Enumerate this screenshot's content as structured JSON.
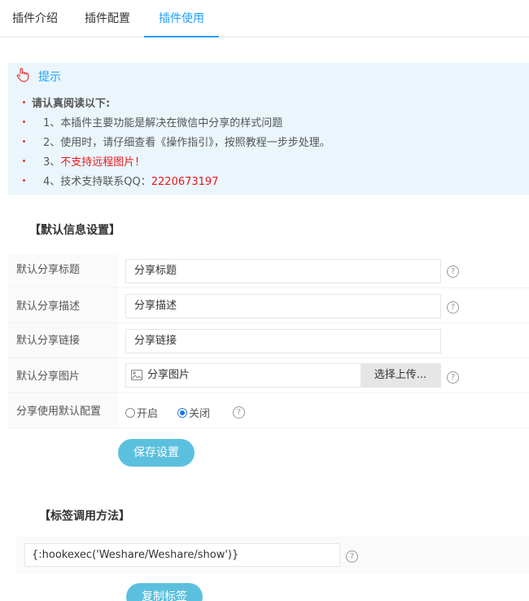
{
  "tabs": [
    {
      "label": "插件介绍"
    },
    {
      "label": "插件配置"
    },
    {
      "label": "插件使用"
    }
  ],
  "tip": {
    "title": "提示",
    "heading": "请认真阅读以下:",
    "items": [
      {
        "text": "1、本插件主要功能是解决在微信中分享的样式问题"
      },
      {
        "text": "2、使用时，请仔细查看《操作指引》，按照教程一步步处理。"
      },
      {
        "prefix": "3、",
        "highlight": "不支持远程图片！"
      },
      {
        "prefix": "4、技术支持联系QQ：",
        "highlight": "2220673197"
      }
    ]
  },
  "settings": {
    "section_title": "【默认信息设置】",
    "title_label": "默认分享标题",
    "title_value": "分享标题",
    "desc_label": "默认分享描述",
    "desc_value": "分享描述",
    "link_label": "默认分享链接",
    "link_value": "分享链接",
    "image_label": "默认分享图片",
    "image_value": "分享图片",
    "upload_label": "选择上传...",
    "use_default_label": "分享使用默认配置",
    "option_on": "开启",
    "option_off": "关闭",
    "selected": "关闭",
    "save_label": "保存设置"
  },
  "tag": {
    "section_title": "【标签调用方法】",
    "code": "{:hookexec('Weshare/Weshare/show')}",
    "copy_label": "复制标签"
  },
  "colors": {
    "accent": "#1e9fff",
    "button": "#5bc0de",
    "tip_bg": "#eaf6fc",
    "warning": "#e8171d"
  }
}
